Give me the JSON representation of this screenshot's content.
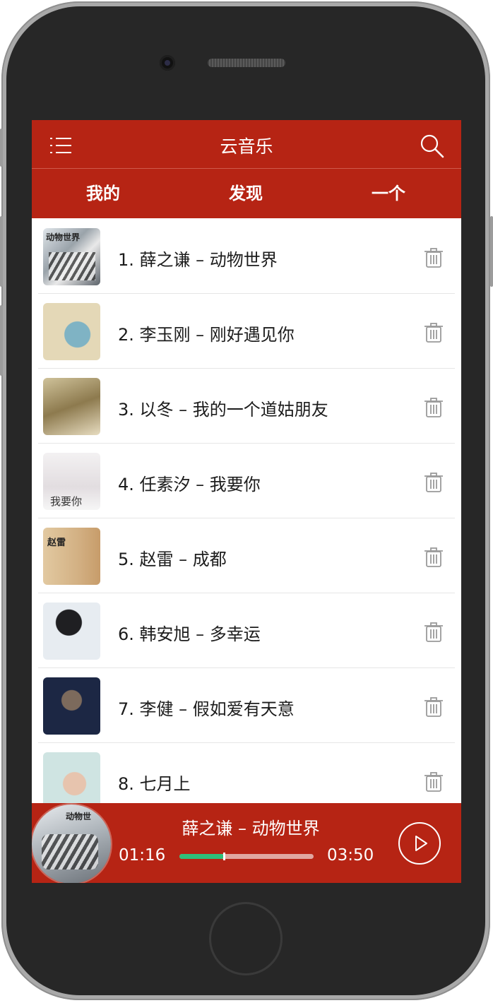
{
  "app": {
    "title": "云音乐"
  },
  "tabs": [
    {
      "label": "我的",
      "active": true
    },
    {
      "label": "发现",
      "active": false
    },
    {
      "label": "一个",
      "active": false
    }
  ],
  "songs": [
    {
      "text": "1.  薛之谦 – 动物世界",
      "cover_text": "动物世界"
    },
    {
      "text": "2.  李玉刚 – 刚好遇见你",
      "cover_text": ""
    },
    {
      "text": "3.  以冬 – 我的一个道姑朋友",
      "cover_text": ""
    },
    {
      "text": "4.  任素汐 – 我要你",
      "cover_text": "我要你"
    },
    {
      "text": "5.  赵雷 – 成都",
      "cover_text": "赵雷"
    },
    {
      "text": "6.  韩安旭 – 多幸运",
      "cover_text": ""
    },
    {
      "text": "7.  李健 – 假如爱有天意",
      "cover_text": ""
    },
    {
      "text": "8.  七月上",
      "cover_text": ""
    }
  ],
  "player": {
    "now_playing": "薛之谦 – 动物世界",
    "current_time": "01:16",
    "total_time": "03:50",
    "progress": 0.33,
    "disc_text": "动物世"
  },
  "colors": {
    "primary": "#b62414",
    "progress": "#2fbf79",
    "track": "#e0a7a0"
  }
}
